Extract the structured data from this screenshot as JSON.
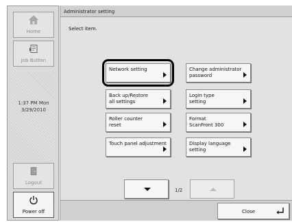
{
  "sidebar": {
    "home_label": "Home",
    "job_button_label": "Job Button",
    "clock_time": "1:37 PM  Mon",
    "clock_date": "3/29/2010",
    "logout_label": "Logout",
    "power_label": "Power off"
  },
  "header": {
    "title": "Administrator setting"
  },
  "main": {
    "instruction": "Select item.",
    "options": [
      {
        "label": "Network setting"
      },
      {
        "label": "Change administrator\npassword"
      },
      {
        "label": "Back up/Restore\nall settings"
      },
      {
        "label": "Login type\nsetting"
      },
      {
        "label": "Roller counter\nreset"
      },
      {
        "label": "Format\nScanFront 300"
      },
      {
        "label": "Touch panel adjustment"
      },
      {
        "label": "Display language\nsetting"
      }
    ],
    "highlighted_option": "Network setting",
    "page_indicator": "1/2"
  },
  "footer": {
    "close_label": "Close"
  },
  "icons": {
    "home": "home-icon",
    "job": "job-button-icon",
    "logout": "logout-icon",
    "power": "power-icon",
    "arrow": "chevron-right-icon",
    "enter": "enter-return-icon"
  }
}
